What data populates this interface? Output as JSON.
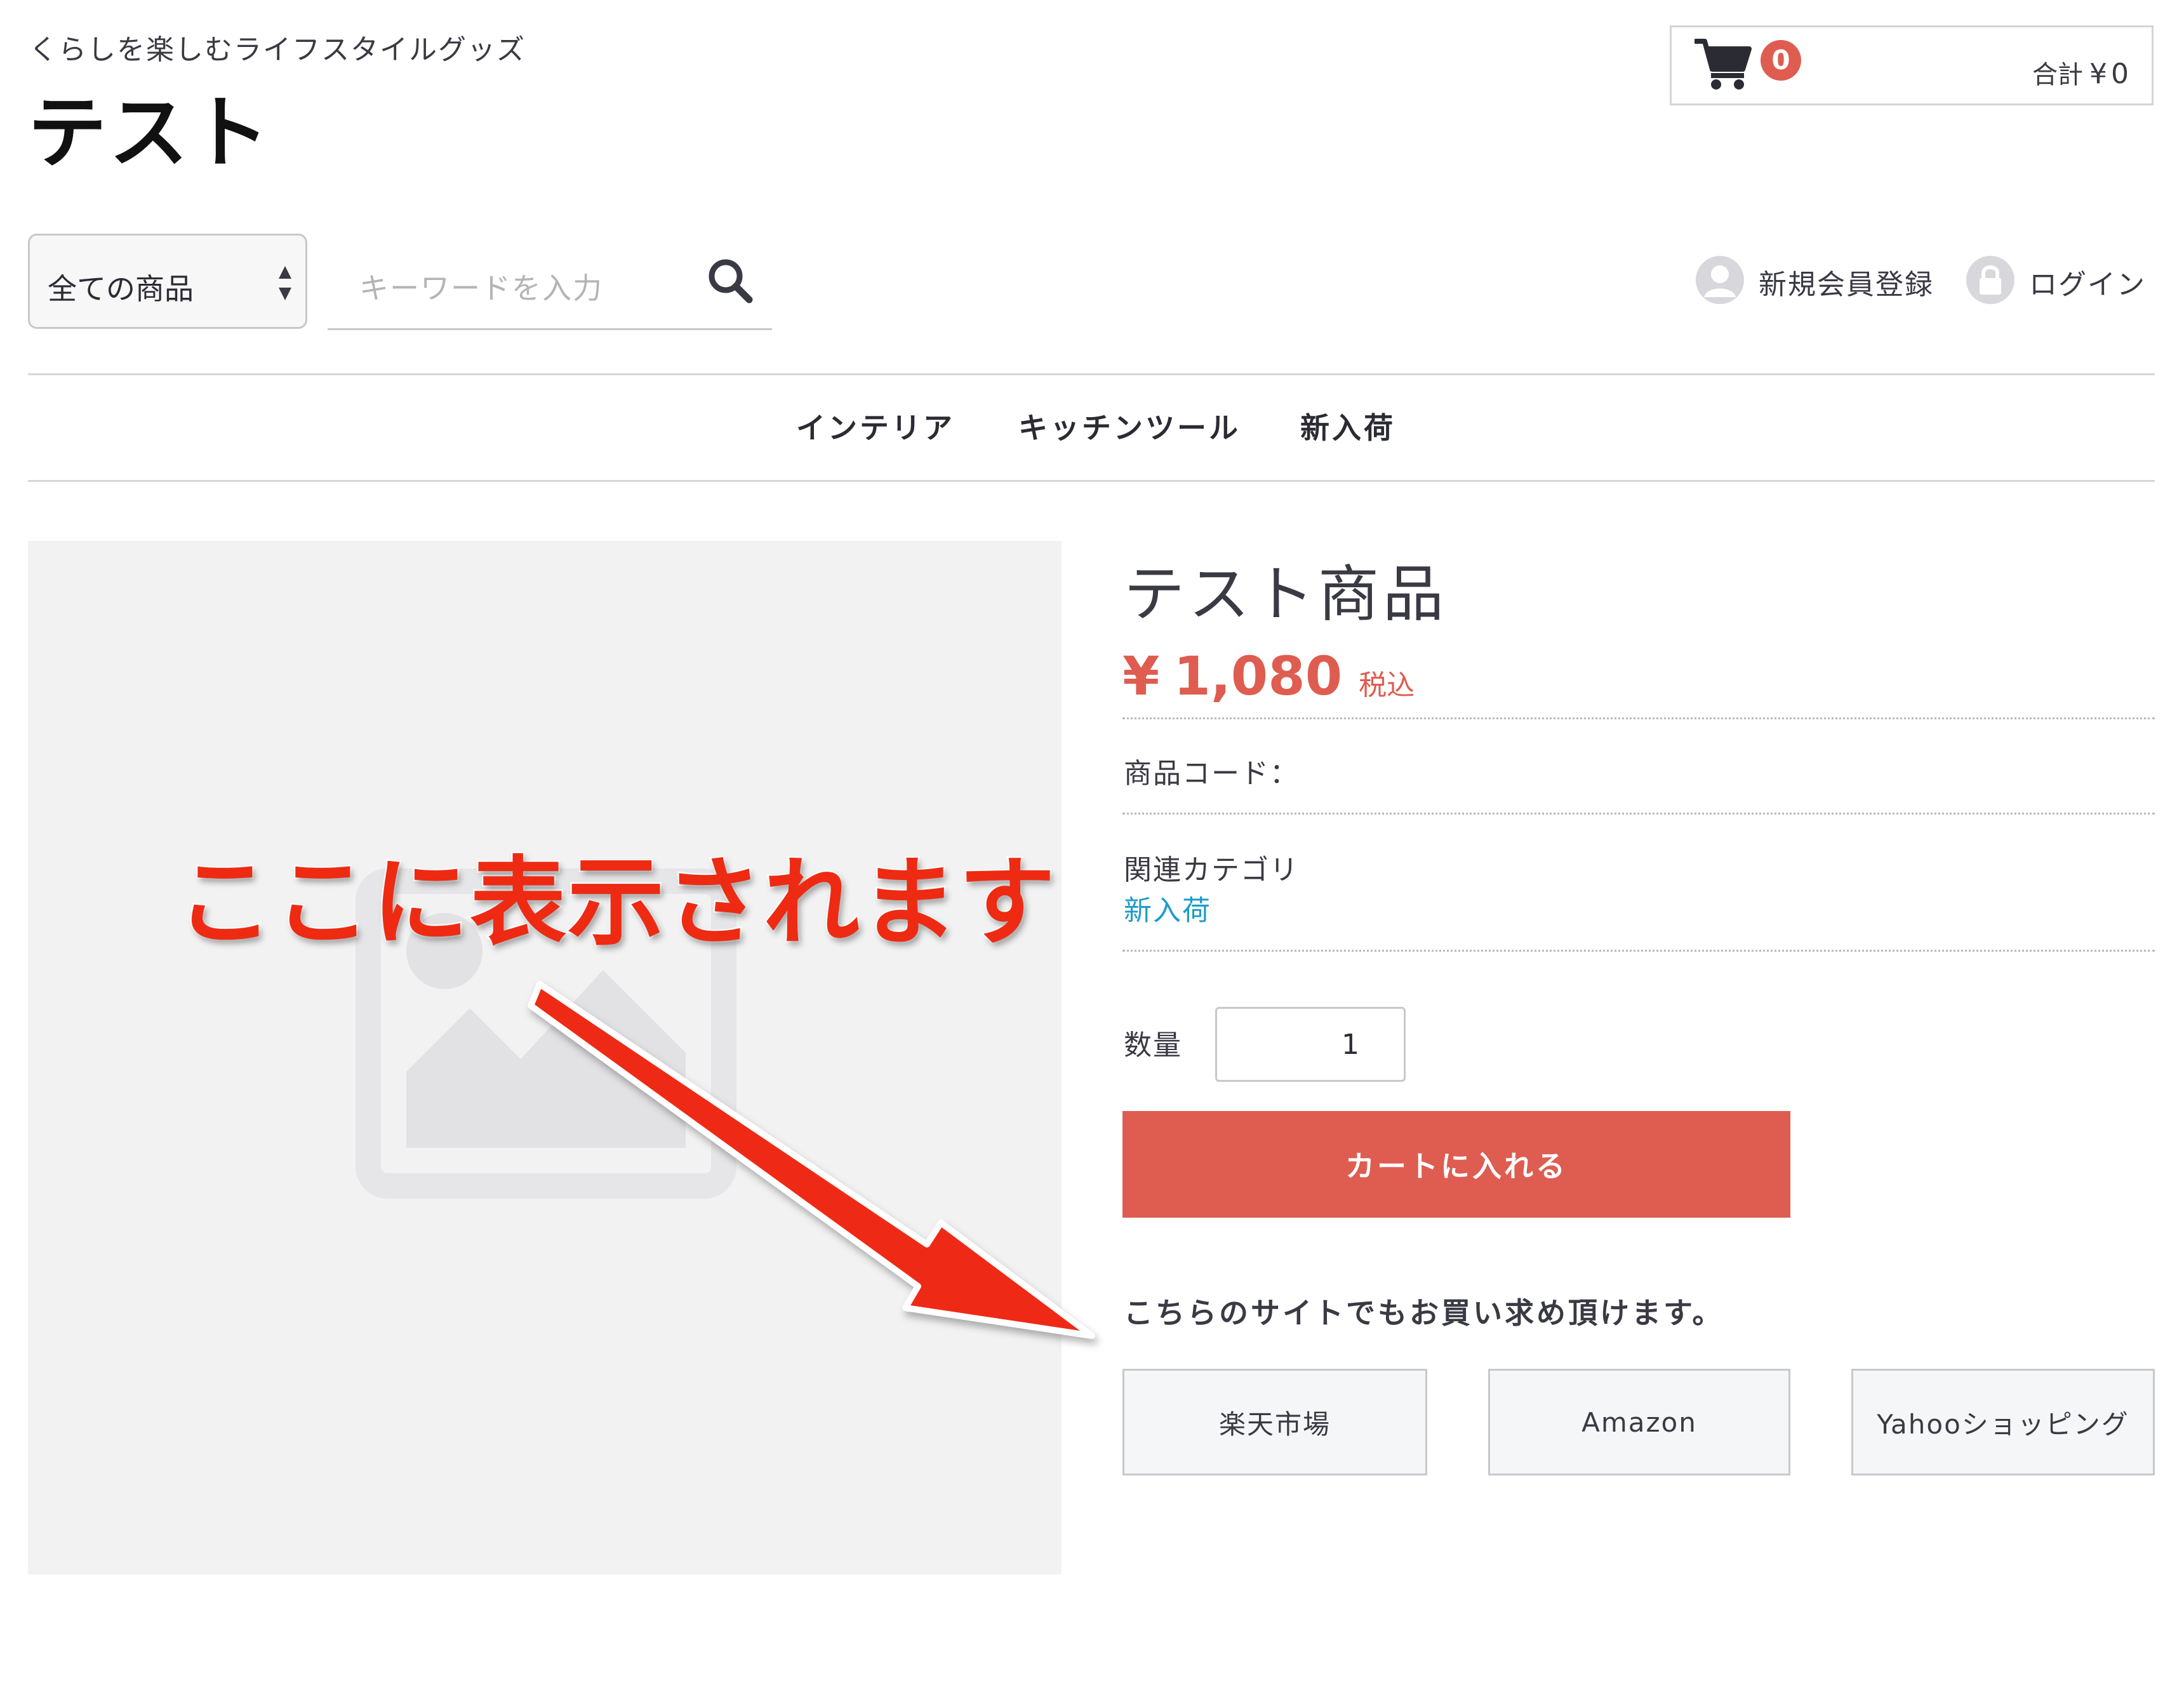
{
  "header": {
    "tagline": "くらしを楽しむライフスタイルグッズ",
    "site_title": "テスト",
    "cart": {
      "count": "0",
      "total_label": "合計",
      "total_currency": "¥",
      "total_value": "0"
    }
  },
  "search": {
    "category_selected": "全ての商品",
    "placeholder": "キーワードを入力"
  },
  "account": {
    "register_label": "新規会員登録",
    "login_label": "ログイン"
  },
  "nav": {
    "items": [
      {
        "label": "インテリア"
      },
      {
        "label": "キッチンツール"
      },
      {
        "label": "新入荷"
      }
    ]
  },
  "annotation": {
    "text": "ここに表示されます"
  },
  "product": {
    "name": "テスト商品",
    "price_currency": "¥",
    "price_value": "1,080",
    "price_tax": "税込",
    "code_label": "商品コード：",
    "related_label": "関連カテゴリ",
    "related_link": "新入荷",
    "quantity_label": "数量",
    "quantity_value": "1",
    "add_to_cart_label": "カートに入れる",
    "other_sites_label": "こちらのサイトでもお買い求め頂けます。",
    "stores": [
      {
        "label": "楽天市場"
      },
      {
        "label": "Amazon"
      },
      {
        "label": "Yahooショッピング"
      }
    ]
  },
  "colors": {
    "accent": "#de5d50",
    "link": "#1e9cc8",
    "annotation": "#ee2a12",
    "image_bg": "#f2f2f3"
  },
  "icons": {
    "cart": "cart-icon",
    "search": "search-icon",
    "user": "user-icon",
    "lock": "lock-icon",
    "select_arrows": "select-arrows-icon",
    "image_placeholder": "image-placeholder-icon",
    "annotation_arrow": "arrow-icon"
  }
}
